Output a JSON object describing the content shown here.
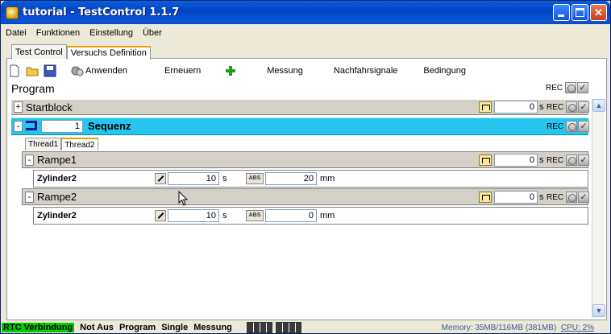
{
  "window": {
    "title": "tutorial - TestControl 1.1.7"
  },
  "menu": [
    "Datei",
    "Funktionen",
    "Einstellung",
    "Über"
  ],
  "tabs": [
    "Test Control",
    "Versuchs Definition"
  ],
  "toolbar": {
    "anwenden": "Anwenden",
    "erneuern": "Erneuern",
    "messung": "Messung",
    "nachfahrsignale": "Nachfahrsignale",
    "bedingung": "Bedingung"
  },
  "program": {
    "label": "Program",
    "rec": "REC"
  },
  "startblock": {
    "title": "Startblock",
    "value": "0",
    "unit": "s",
    "rec": "REC",
    "expand": "+"
  },
  "sequenz": {
    "title": "Sequenz",
    "count": "1",
    "rec": "REC",
    "expand": "-"
  },
  "threads": [
    "Thread1",
    "Thread2"
  ],
  "rampe1": {
    "title": "Rampe1",
    "value": "0",
    "unit": "s",
    "rec": "REC",
    "expand": "-",
    "param": {
      "name": "Zylinder2",
      "time": "10",
      "time_unit": "s",
      "abs": "ABS",
      "pos": "20",
      "pos_unit": "mm"
    }
  },
  "rampe2": {
    "title": "Rampe2",
    "value": "0",
    "unit": "s",
    "rec": "REC",
    "expand": "-",
    "param": {
      "name": "Zylinder2",
      "time": "10",
      "time_unit": "s",
      "abs": "ABS",
      "pos": "0",
      "pos_unit": "mm"
    }
  },
  "status": {
    "rtc": "RTC Verbindung",
    "notaus": "Not Aus",
    "program": "Program",
    "single": "Single",
    "messung": "Messung",
    "memory": "Memory: 35MB/116MB (381MB)",
    "cpu": "CPU: 2%"
  }
}
